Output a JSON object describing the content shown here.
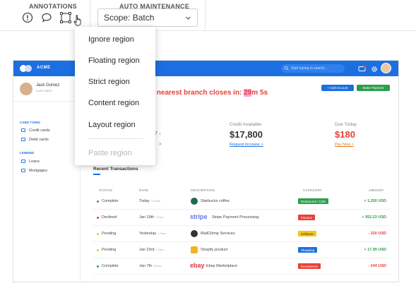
{
  "toolbar": {
    "annotations_label": "ANNOTATIONS",
    "auto_maintenance_label": "AUTO MAINTENANCE",
    "scope_value": "Scope: Batch"
  },
  "menu": {
    "items": [
      "Ignore region",
      "Floating region",
      "Strict region",
      "Content region",
      "Layout region"
    ],
    "disabled_item": "Paste region"
  },
  "app": {
    "brand": "ACME",
    "search_placeholder": "Start typing to search...",
    "user_name": "Jack Gomez",
    "user_role": "CUSTOMER",
    "sidebar": {
      "cards_heading": "CARD TYPES",
      "cards": [
        "Credit cards",
        "Debit cards"
      ],
      "lending_heading": "LENDING",
      "lending": [
        "Loans",
        "Mortgages"
      ]
    },
    "headline_prefix": "ur nearest branch closes in: ",
    "headline_highlight": "29",
    "headline_suffix": "m 5s",
    "add_account": "+ Add Account",
    "make_payment": "Make Payment",
    "credit_label": "Credit Available",
    "credit_value": "$17,800",
    "credit_link": "Request increase >",
    "due_label": "Due Today",
    "due_value": "$180",
    "due_link": "Pay Now >",
    "partial_value": "7 ↓",
    "partial_link": ">",
    "recent_title": "Recent Transactions",
    "columns": [
      "STATUS",
      "DATE",
      "DESCRIPTION",
      "CATEGORY",
      "AMOUNT"
    ],
    "transactions": [
      {
        "status": "Complete",
        "date": "Today",
        "time": "11:00am",
        "desc": "Starbucks coffee",
        "category": "Restaurant / Cafe",
        "amount": "+ 1,250 USD"
      },
      {
        "status": "Declined",
        "date": "Jan 19th",
        "time": "3:22pm",
        "desc": "Stripe Payment Processing",
        "category": "Finance",
        "amount": "+ 952.23 USD"
      },
      {
        "status": "Pending",
        "date": "Yesterday",
        "time": "7:41am",
        "desc": "MailChimp Services",
        "category": "Software",
        "amount": "- 320 USD"
      },
      {
        "status": "Pending",
        "date": "Jan 23rd",
        "time": "2:12pm",
        "desc": "Shopify product",
        "category": "Shopping",
        "amount": "+ 17.99 USD"
      },
      {
        "status": "Complete",
        "date": "Jan 7th",
        "time": "9:51am",
        "desc": "Ebay Marketplace",
        "category": "Ecommerce",
        "amount": "- 244 USD"
      }
    ],
    "stripe_logo": "stripe",
    "ebay_logo": "ebay"
  },
  "colors": {
    "brand_blue": "#1c6fe0",
    "green": "#2c9e4b",
    "red": "#e8403a",
    "orange": "#e07b1c",
    "highlight": "#f7a1e6",
    "cat_restaurant": "#2c9e4b",
    "cat_finance": "#e8403a",
    "cat_software": "#f5c518",
    "cat_shopping": "#1c6fe0",
    "cat_ecommerce": "#e8403a"
  }
}
